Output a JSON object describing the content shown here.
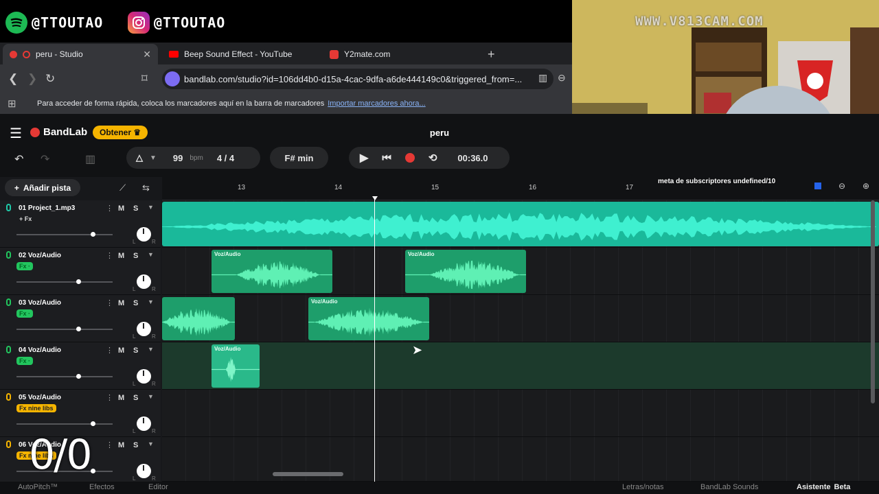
{
  "social": {
    "spotify_handle": "@TTOUTAO",
    "instagram_handle": "@TTOUTAO"
  },
  "browser": {
    "tabs": [
      {
        "label": "peru - Studio",
        "active": true
      },
      {
        "label": "Beep Sound Effect - YouTube",
        "active": false
      },
      {
        "label": "Y2mate.com",
        "active": false
      }
    ],
    "url": "bandlab.com/studio?id=106dd4b0-d15a-4cac-9dfa-a6de444149c0&triggered_from=...",
    "bookmarks_text": "Para acceder de forma rápida, coloca los marcadores aquí en la barra de marcadores",
    "bookmarks_link": "Importar marcadores ahora..."
  },
  "bandlab": {
    "logo": "BandLab",
    "get_button": "Obtener",
    "project_name": "peru",
    "bpm_value": "99",
    "bpm_unit": "bpm",
    "time_signature": "4 / 4",
    "key": "F# min",
    "time": "00:36.0",
    "add_track": "Añadir pista",
    "ruler_ticks": [
      "13",
      "14",
      "15",
      "16",
      "17"
    ],
    "tracks": [
      {
        "name": "01  Project_1.mp3",
        "fx": "+ Fx",
        "color": "#1fc9a8",
        "volume": 0.8
      },
      {
        "name": "02  Voz/Audio",
        "fx": "Fx ·",
        "color": "#22c55e",
        "volume": 0.65
      },
      {
        "name": "03  Voz/Audio",
        "fx": "Fx ·",
        "color": "#22c55e",
        "volume": 0.65
      },
      {
        "name": "04  Voz/Audio",
        "fx": "Fx ·",
        "color": "#22c55e",
        "volume": 0.65
      },
      {
        "name": "05  Voz/Audio",
        "fx": "Fx  nine libs",
        "color": "#f5b400",
        "volume": 0.8
      },
      {
        "name": "06  Voz/Audio",
        "fx": "Fx  nine libs",
        "color": "#f5b400",
        "volume": 0.8
      }
    ],
    "clip_label": "Voz/Audio",
    "mute": "M",
    "solo": "S",
    "pan_left": "L",
    "pan_right": "R",
    "bottom": {
      "autopitch": "AutoPitch™",
      "effects": "Efectos",
      "editor": "Editor",
      "lyrics": "Letras/notas",
      "sounds": "BandLab Sounds",
      "assistant": "Asistente",
      "beta": "Beta"
    }
  },
  "overlay": {
    "counter": "0/0",
    "subscriber_goal": "meta de subscriptores undefined/10"
  },
  "webcam": {
    "watermark": "WWW.V813CAM.COM"
  }
}
